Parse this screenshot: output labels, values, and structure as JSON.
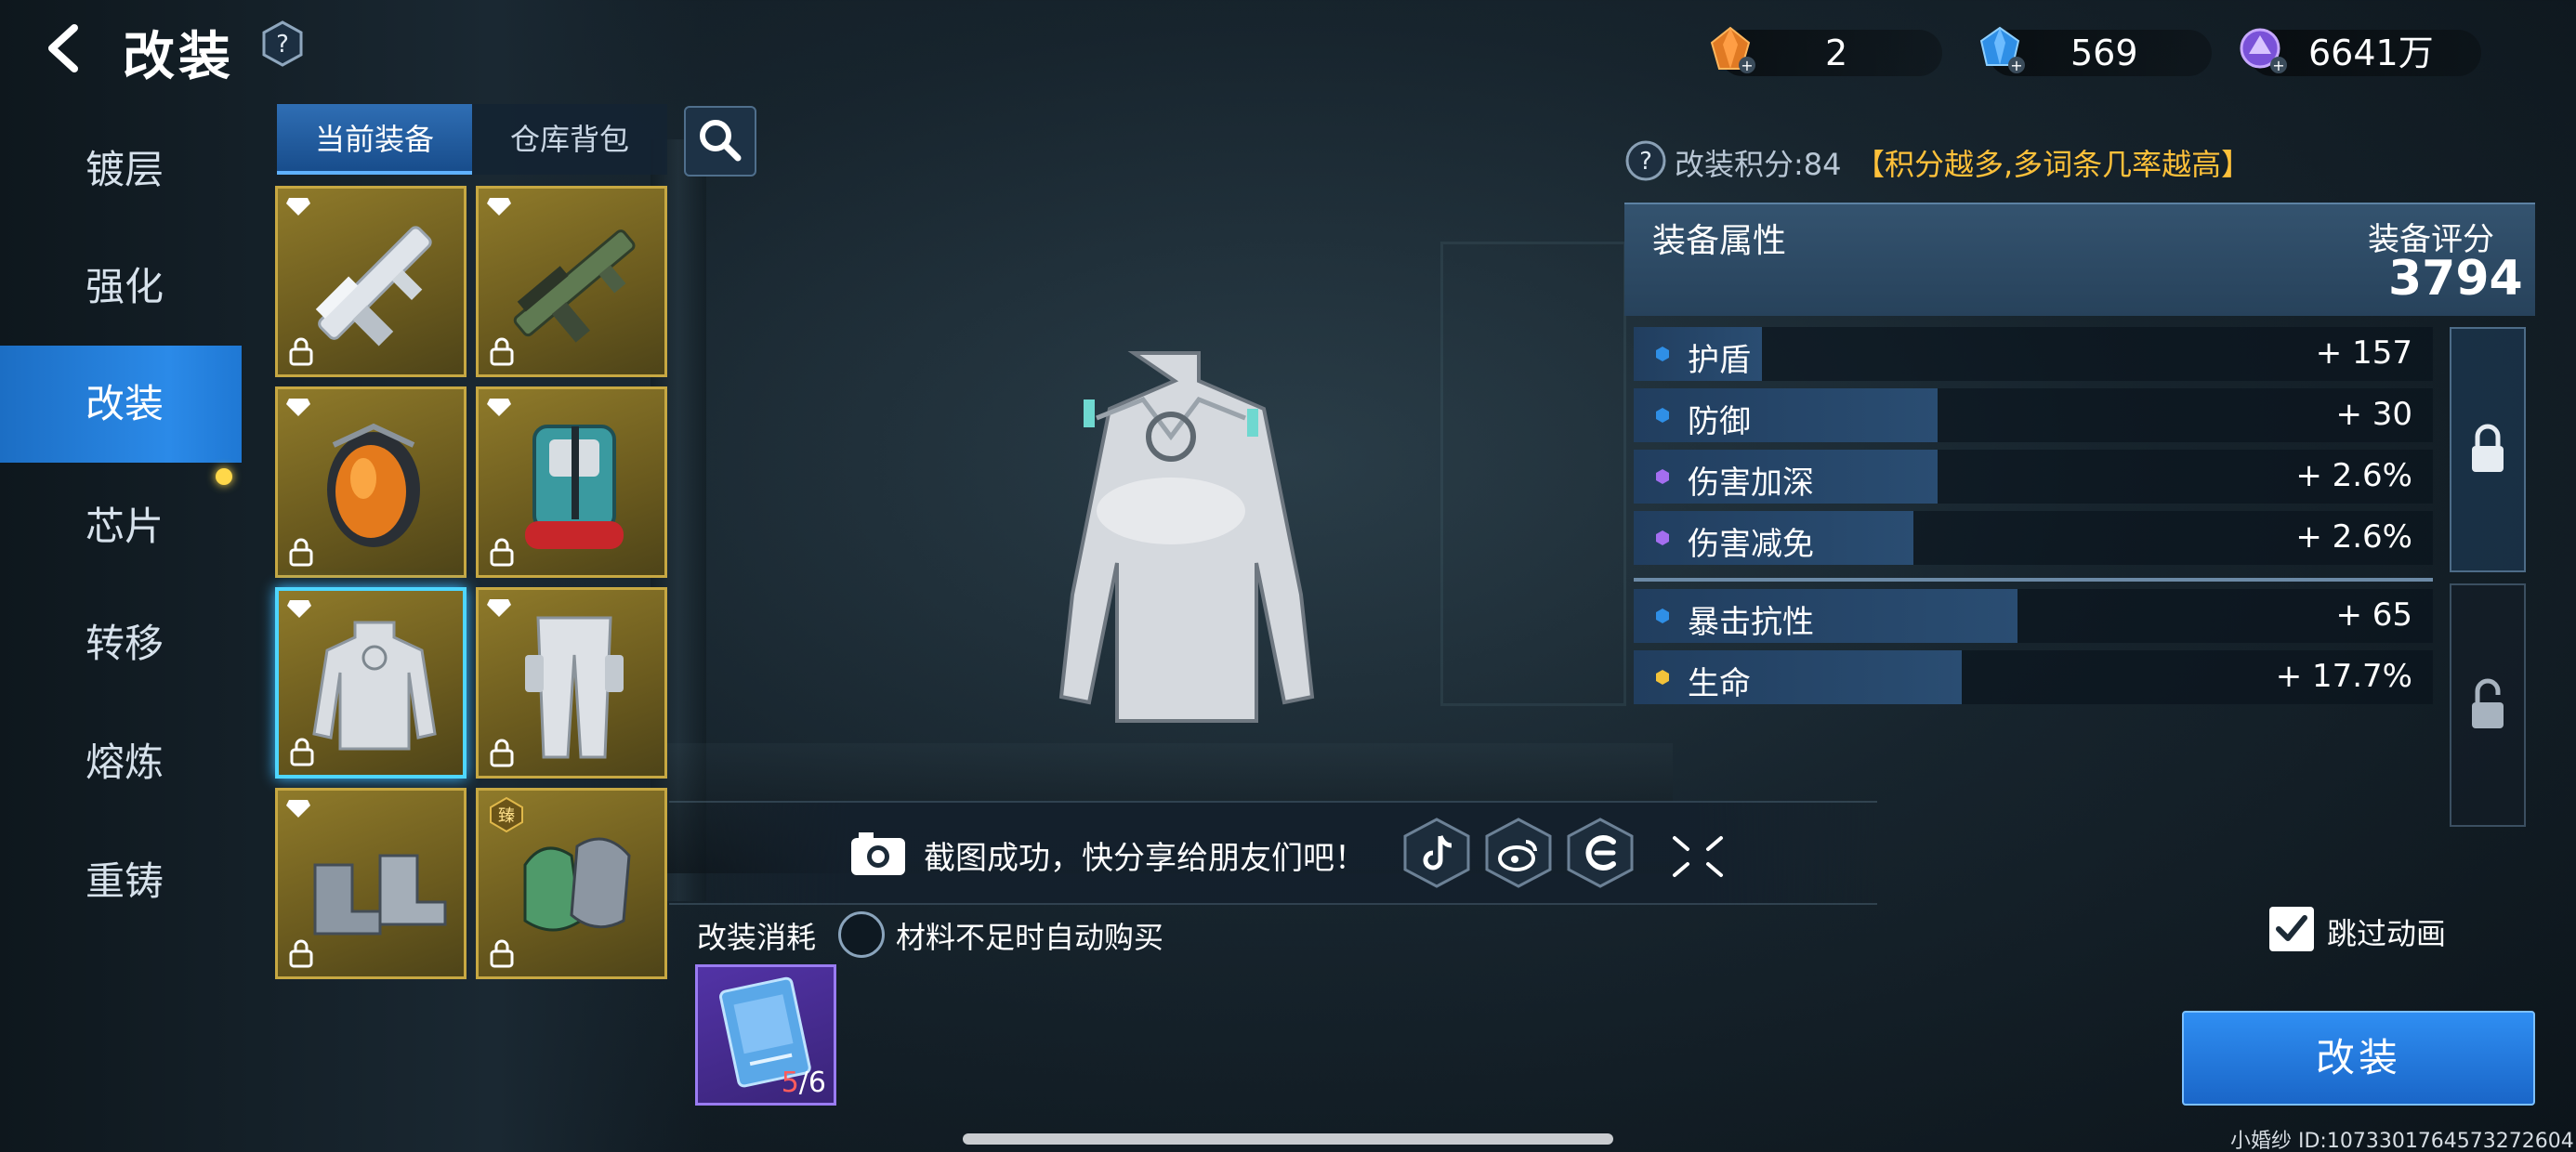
{
  "header": {
    "title": "改装",
    "back_icon": "back-arrow-icon",
    "help_icon": "question-mark-icon"
  },
  "currencies": [
    {
      "icon": "orange-crystal-icon",
      "value": "2",
      "accent": "#f08a2a"
    },
    {
      "icon": "blue-gem-icon",
      "value": "569",
      "accent": "#3aa6ff"
    },
    {
      "icon": "purple-coin-icon",
      "value": "6641万",
      "accent": "#b690ff"
    }
  ],
  "nav": {
    "items": [
      {
        "label": "镀层"
      },
      {
        "label": "强化"
      },
      {
        "label": "改装",
        "active": true
      },
      {
        "label": "芯片",
        "has_notification": true
      },
      {
        "label": "转移"
      },
      {
        "label": "熔炼"
      },
      {
        "label": "重铸"
      }
    ]
  },
  "tabs": {
    "current": "当前装备",
    "warehouse": "仓库背包",
    "search_icon": "search-icon"
  },
  "inventory": [
    {
      "name": "rifle-silver",
      "icon": "silver-rifle-icon",
      "locked": true
    },
    {
      "name": "rifle-green",
      "icon": "green-rifle-icon",
      "locked": true
    },
    {
      "name": "helmet",
      "icon": "helmet-icon",
      "locked": true
    },
    {
      "name": "backpack",
      "icon": "backpack-icon",
      "locked": true
    },
    {
      "name": "armor-top",
      "icon": "armor-top-icon",
      "locked": true,
      "selected": true
    },
    {
      "name": "armor-pants",
      "icon": "armor-pants-icon",
      "locked": true
    },
    {
      "name": "boots",
      "icon": "boots-icon",
      "locked": true
    },
    {
      "name": "gloves",
      "icon": "gloves-icon",
      "locked": true,
      "badge": "臻"
    }
  ],
  "score": {
    "label": "改装积分:84",
    "tip": "【积分越多,多词条几率越高】"
  },
  "stats": {
    "header": "装备属性",
    "rating_label": "装备评分",
    "rating_value": "3794",
    "rows": [
      {
        "name": "护盾",
        "value": "+ 157",
        "fill": 0.16,
        "quality": "blue"
      },
      {
        "name": "防御",
        "value": "+ 30",
        "fill": 0.38,
        "quality": "blue"
      },
      {
        "name": "伤害加深",
        "value": "+ 2.6%",
        "fill": 0.38,
        "quality": "purple"
      },
      {
        "name": "伤害减免",
        "value": "+ 2.6%",
        "fill": 0.35,
        "quality": "purple"
      },
      {
        "name": "暴击抗性",
        "value": "+ 65",
        "fill": 0.48,
        "quality": "blue"
      },
      {
        "name": "生命",
        "value": "+ 17.7%",
        "fill": 0.41,
        "quality": "gold"
      }
    ],
    "lock_icon": "lock-icon"
  },
  "share": {
    "camera_icon": "camera-icon",
    "text": "截图成功，快分享给朋友们吧！",
    "targets": [
      "tiktok-icon",
      "weibo-icon",
      "share-c-icon"
    ],
    "collapse_icon": "collapse-icon"
  },
  "cost": {
    "label": "改装消耗",
    "auto_buy": "材料不足时自动购买",
    "material_icon": "mod-card-icon",
    "have": "5",
    "need": "/6"
  },
  "skip": {
    "label": "跳过动画",
    "checked": true
  },
  "action": {
    "label": "改装"
  },
  "footer": {
    "id_text": "小婚纱  ID:107330176457327260​4"
  },
  "colors": {
    "accent_blue": "#2b8ae8",
    "tip_gold": "#ffc13a",
    "stat_blue": "#2f8fe6",
    "stat_purple": "#a46ef0",
    "stat_gold": "#f2c23a"
  }
}
